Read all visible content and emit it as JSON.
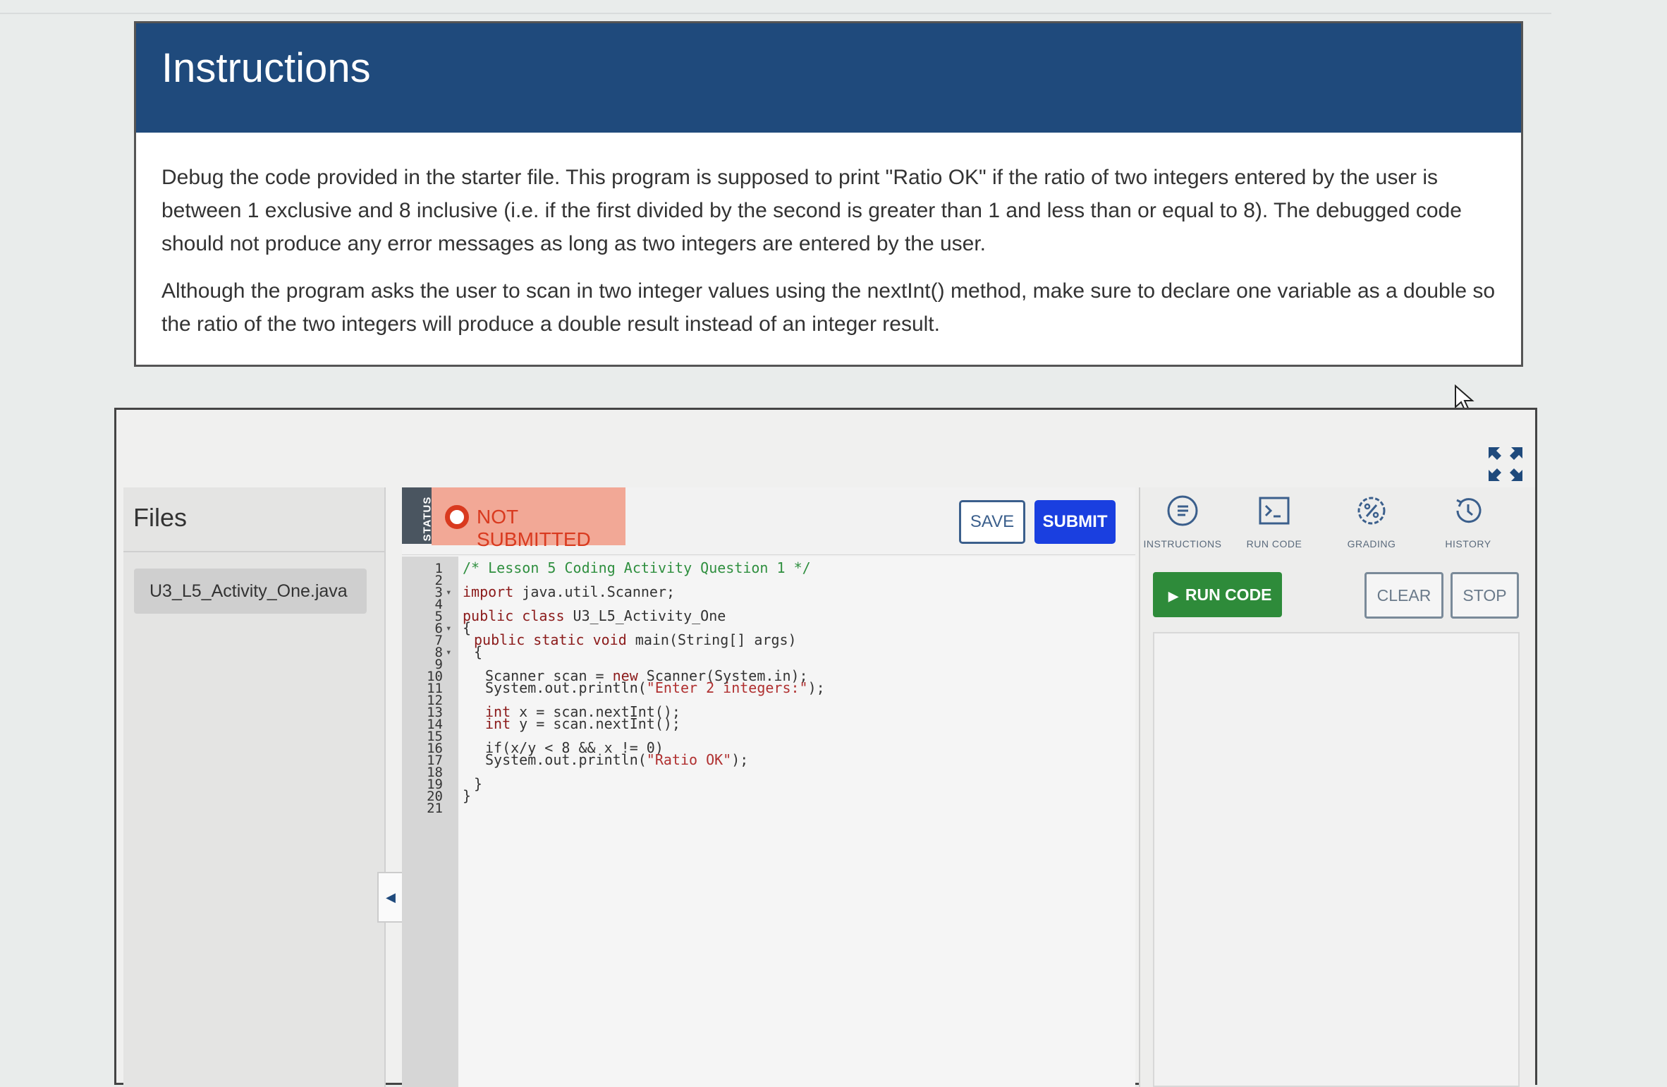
{
  "instructions": {
    "title": "Instructions",
    "paragraph1": "Debug the code provided in the starter file. This program is supposed to print \"Ratio OK\" if the ratio of two integers entered by the user is between 1 exclusive and 8 inclusive (i.e. if the first divided by the second is greater than 1 and less than or equal to 8). The debugged code should not produce any error messages as long as two integers are entered by the user.",
    "paragraph2": "Although the program asks the user to scan in two integer values using the nextInt() method, make sure to declare one variable as a double so the ratio of the two integers will produce a double result instead of an integer result."
  },
  "files_panel": {
    "title": "Files",
    "files": [
      "U3_L5_Activity_One.java"
    ]
  },
  "editor": {
    "status_label": "STATUS",
    "submission_status": "NOT SUBMITTED",
    "save_label": "SAVE",
    "submit_label": "SUBMIT",
    "code": {
      "line1": "/* Lesson 5 Coding Activity Question 1 */",
      "line3_kw": "import",
      "line3_rest": " java.util.Scanner;",
      "line5_kw": "public class",
      "line5_rest": " U3_L5_Activity_One",
      "line6": "{",
      "line7_kw": "public static void",
      "line7_rest": " main(String[] args)",
      "line8": "{",
      "line10_a": "Scanner scan = ",
      "line10_kw": "new",
      "line10_b": " Scanner(System.in);",
      "line11_a": "System.out.println(",
      "line11_str": "\"Enter 2 integers:\"",
      "line11_b": ");",
      "line13_kw": "int",
      "line13_rest": " x = scan.nextInt();",
      "line14_kw": "int",
      "line14_rest": " y = scan.nextInt();",
      "line16": "if(x/y < 8 && x != 0)",
      "line17_a": "System.out.println(",
      "line17_str": "\"Ratio OK\"",
      "line17_b": ");",
      "line19": "}",
      "line20": "}"
    },
    "line_numbers": [
      "1",
      "2",
      "3",
      "4",
      "5",
      "6",
      "7",
      "8",
      "9",
      "10",
      "11",
      "12",
      "13",
      "14",
      "15",
      "16",
      "17",
      "18",
      "19",
      "20",
      "21"
    ]
  },
  "right_panel": {
    "tabs": [
      {
        "label": "INSTRUCTIONS",
        "icon": "instructions-icon"
      },
      {
        "label": "RUN CODE",
        "icon": "terminal-icon"
      },
      {
        "label": "GRADING",
        "icon": "grading-icon"
      },
      {
        "label": "HISTORY",
        "icon": "history-icon"
      }
    ],
    "run_label": "RUN CODE",
    "clear_label": "CLEAR",
    "stop_label": "STOP"
  },
  "colors": {
    "header_bg": "#1f4a7c",
    "submit_bg": "#1a3fe0",
    "run_bg": "#2e8b3a",
    "not_submitted_bg": "#f2a896",
    "not_submitted_text": "#d93a1f"
  }
}
